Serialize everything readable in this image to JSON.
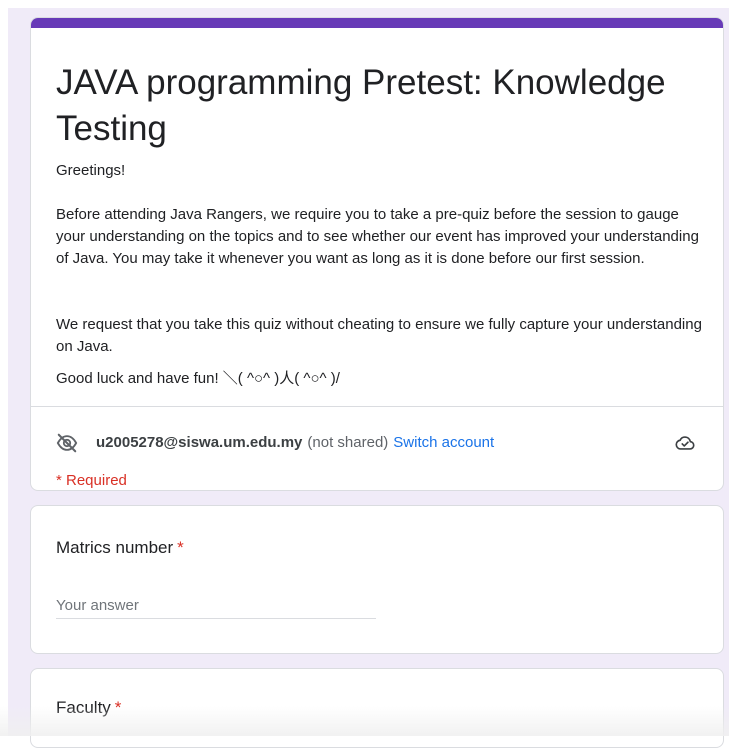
{
  "form": {
    "title": "JAVA programming Pretest: Knowledge Testing",
    "accent_color": "#673ab7",
    "description": {
      "greeting": "Greetings!",
      "paragraph1": "Before attending Java Rangers, we require you to take a pre-quiz before the session to gauge your understanding on the topics and to see whether our event has improved your understanding of Java. You may take it whenever you want as long as it is done before our first session.",
      "paragraph2": "We request that you take this quiz without cheating to ensure we fully capture your understanding on Java.",
      "closing": "Good luck and have fun! ＼( ^○^ )人( ^○^ )/"
    },
    "account": {
      "icon": "eye-off-icon",
      "email": "u2005278@siswa.um.edu.my",
      "visibility_note": "(not shared)",
      "switch_label": "Switch account",
      "cloud_icon": "cloud-check-icon"
    },
    "required_note": "* Required"
  },
  "questions": [
    {
      "title": "Matrics number",
      "required_marker": "*",
      "placeholder": "Your answer",
      "value": ""
    },
    {
      "title": "Faculty",
      "required_marker": "*"
    }
  ]
}
